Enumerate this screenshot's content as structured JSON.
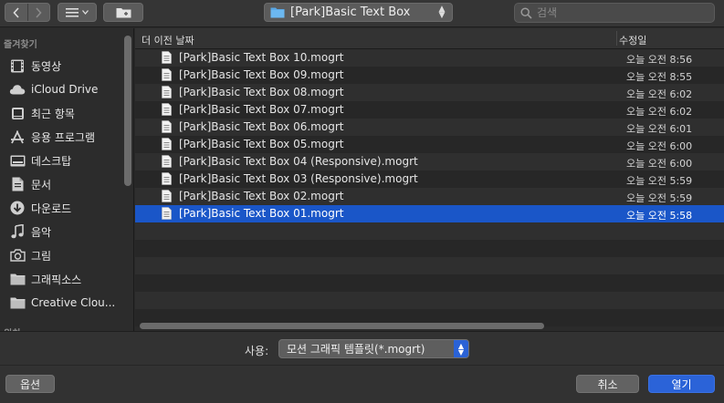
{
  "toolbar": {
    "back_icon": "chevron-left",
    "forward_icon": "chevron-right",
    "view_icon": "list-view",
    "new_folder_icon": "new-folder",
    "path": "[Park]Basic Text Box",
    "search_placeholder": "검색"
  },
  "sidebar": {
    "section_favorites": "즐겨찾기",
    "section_locations": "위치",
    "items": [
      {
        "label": "동영상",
        "icon": "film-icon"
      },
      {
        "label": "iCloud Drive",
        "icon": "cloud-icon"
      },
      {
        "label": "최근 항목",
        "icon": "clock-icon"
      },
      {
        "label": "응용 프로그램",
        "icon": "apps-icon"
      },
      {
        "label": "데스크탑",
        "icon": "desktop-icon"
      },
      {
        "label": "문서",
        "icon": "document-icon"
      },
      {
        "label": "다운로드",
        "icon": "download-icon"
      },
      {
        "label": "음악",
        "icon": "music-icon"
      },
      {
        "label": "그림",
        "icon": "camera-icon"
      },
      {
        "label": "그래픽소스",
        "icon": "folder-icon"
      },
      {
        "label": "Creative Clou...",
        "icon": "folder-icon"
      }
    ]
  },
  "filelist": {
    "col_name": "더 이전 날짜",
    "col_date": "수정일",
    "files": [
      {
        "name": "[Park]Basic Text Box 10.mogrt",
        "date": "오늘 오전 8:56"
      },
      {
        "name": "[Park]Basic Text Box 09.mogrt",
        "date": "오늘 오전 8:55"
      },
      {
        "name": "[Park]Basic Text Box 08.mogrt",
        "date": "오늘 오전 6:02"
      },
      {
        "name": "[Park]Basic Text Box 07.mogrt",
        "date": "오늘 오전 6:02"
      },
      {
        "name": "[Park]Basic Text Box 06.mogrt",
        "date": "오늘 오전 6:01"
      },
      {
        "name": "[Park]Basic Text Box 05.mogrt",
        "date": "오늘 오전 6:00"
      },
      {
        "name": "[Park]Basic Text Box 04 (Responsive).mogrt",
        "date": "오늘 오전 6:00"
      },
      {
        "name": "[Park]Basic Text Box 03 (Responsive).mogrt",
        "date": "오늘 오전 5:59"
      },
      {
        "name": "[Park]Basic Text Box 02.mogrt",
        "date": "오늘 오전 5:59"
      },
      {
        "name": "[Park]Basic Text Box 01.mogrt",
        "date": "오늘 오전 5:58",
        "selected": true
      }
    ]
  },
  "options": {
    "usage_label": "사용:",
    "file_type": "모션 그래픽 템플릿(*.mogrt)"
  },
  "buttons": {
    "options": "옵션",
    "cancel": "취소",
    "open": "열기"
  },
  "colors": {
    "selection": "#1a56c8",
    "accent": "#2b63d8",
    "folder": "#5aa8e6"
  }
}
